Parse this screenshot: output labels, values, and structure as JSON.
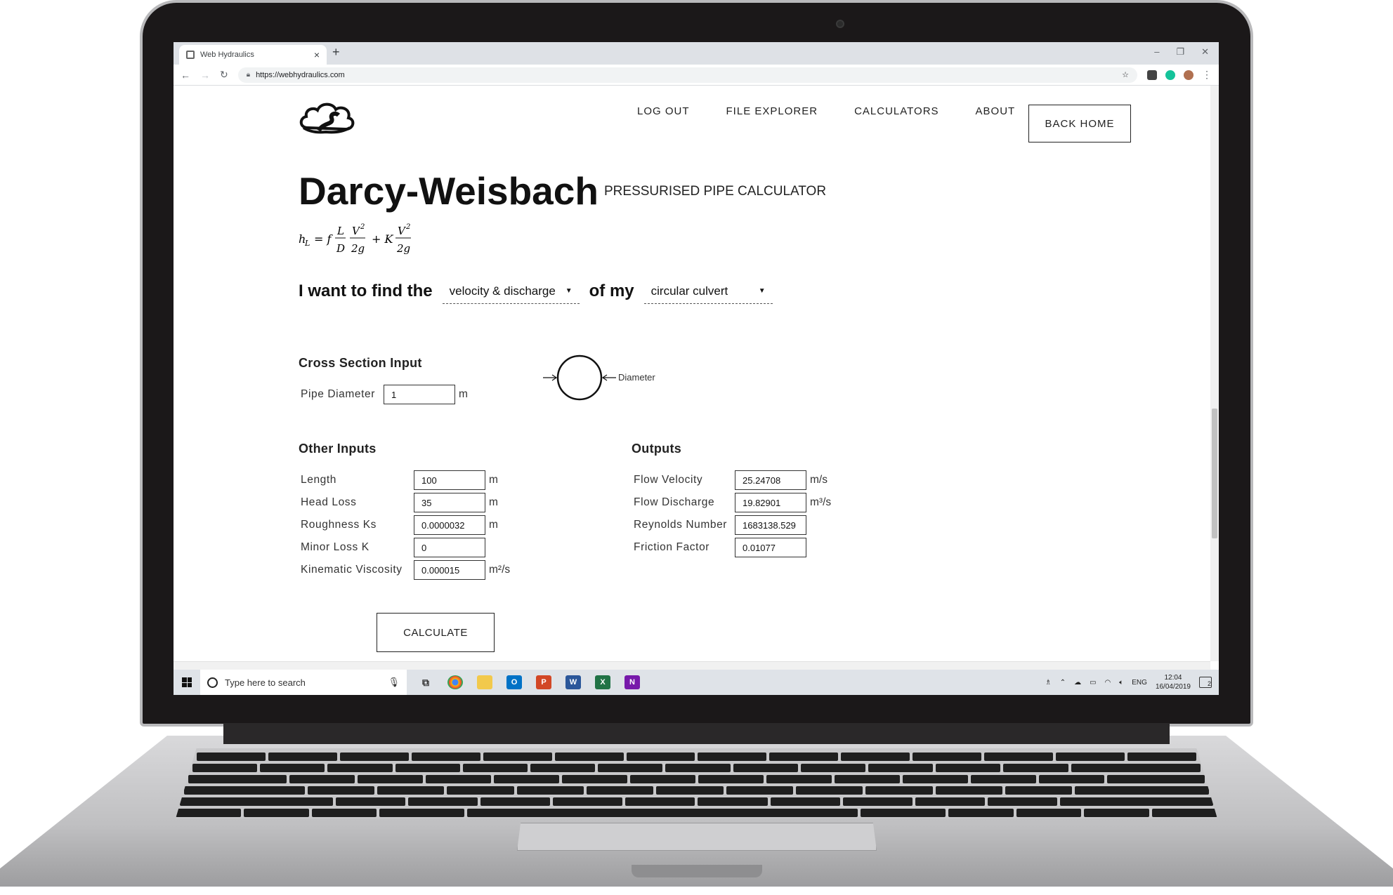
{
  "browser": {
    "tab_title": "Web Hydraulics",
    "tab_close": "×",
    "new_tab": "+",
    "url": "https://webhydraulics.com",
    "window_controls": [
      "–",
      "❐",
      "✕"
    ]
  },
  "nav": {
    "items": [
      "LOG OUT",
      "FILE EXPLORER",
      "CALCULATORS",
      "ABOUT"
    ],
    "back_home": "BACK HOME"
  },
  "header": {
    "title": "Darcy-Weisbach",
    "subtitle": "PRESSURISED PIPE CALCULATOR"
  },
  "formula": {
    "lhs": "h",
    "lhs_sub": "L",
    "eq": "= f",
    "frac1_num": "L",
    "frac1_den": "D",
    "frac2_num": "V",
    "frac2_den": "2g",
    "plus": "+ K",
    "frac3_num": "V",
    "frac3_den": "2g",
    "exp": "2"
  },
  "find_row": {
    "prefix": "I want to find the",
    "find_value": "velocity & discharge",
    "middle": "of my",
    "shape_value": "circular culvert"
  },
  "cross_section": {
    "heading": "Cross Section Input",
    "pipe_diameter_label": "Pipe Diameter",
    "pipe_diameter_value": "1",
    "pipe_diameter_unit": "m",
    "diagram_label": "Diameter"
  },
  "other_inputs": {
    "heading": "Other Inputs",
    "fields": [
      {
        "label": "Length",
        "value": "100",
        "unit": "m"
      },
      {
        "label": "Head Loss",
        "value": "35",
        "unit": "m"
      },
      {
        "label": "Roughness Ks",
        "value": "0.0000032",
        "unit": "m"
      },
      {
        "label": "Minor Loss K",
        "value": "0",
        "unit": ""
      },
      {
        "label": "Kinematic Viscosity",
        "value": "0.000015",
        "unit": "m²/s"
      }
    ]
  },
  "outputs": {
    "heading": "Outputs",
    "fields": [
      {
        "label": "Flow Velocity",
        "value": "25.24708",
        "unit": "m/s"
      },
      {
        "label": "Flow Discharge",
        "value": "19.82901",
        "unit": "m³/s"
      },
      {
        "label": "Reynolds Number",
        "value": "1683138.529",
        "unit": ""
      },
      {
        "label": "Friction Factor",
        "value": "0.01077",
        "unit": ""
      }
    ]
  },
  "calculate_label": "CALCULATE",
  "taskbar": {
    "search_placeholder": "Type here to search",
    "language": "ENG",
    "time": "12:04",
    "date": "16/04/2019",
    "notification_count": "2"
  },
  "colors": {
    "chrome_tab_bar": "#dee1e6",
    "taskbar": "#dfe3e8",
    "text": "#222222"
  }
}
